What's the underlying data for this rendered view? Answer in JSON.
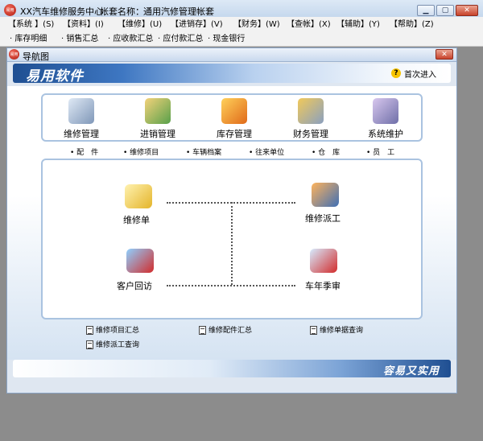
{
  "app": {
    "title": "XX汽车维修服务中心",
    "account_label": "帐套名称：",
    "account_name": "通用汽修管理帐套",
    "icon_text": "易用"
  },
  "menu": [
    {
      "label": "【系统 】(S)"
    },
    {
      "label": "【资料】(I)"
    },
    {
      "label": "【维修】(U)"
    },
    {
      "label": "【进销存】(V)"
    },
    {
      "label": "【财务】(W)"
    },
    {
      "label": "【查帐】(X)"
    },
    {
      "label": "【辅助】(Y)"
    },
    {
      "label": "【帮助】(Z)"
    }
  ],
  "quickbar": [
    {
      "label": "· 库存明细"
    },
    {
      "label": "· 销售汇总"
    },
    {
      "label": "· 应收款汇总"
    },
    {
      "label": "· 应付款汇总"
    },
    {
      "label": "· 现金银行"
    }
  ],
  "navwin": {
    "title": "导航图",
    "icon_text": "易用"
  },
  "banner": {
    "slogan": "易用软件",
    "first_time": "首次进入",
    "help_icon": "?"
  },
  "tools": [
    {
      "label": "维修管理",
      "icon": "car-gear-icon"
    },
    {
      "label": "进销管理",
      "icon": "boxes-icon"
    },
    {
      "label": "库存管理",
      "icon": "warehouse-icon"
    },
    {
      "label": "财务管理",
      "icon": "coins-icon"
    },
    {
      "label": "系统维护",
      "icon": "gears-icon"
    }
  ],
  "sublinks": [
    {
      "label": "• 配　件"
    },
    {
      "label": "• 维修项目"
    },
    {
      "label": "• 车辆档案"
    },
    {
      "label": "• 往来单位"
    },
    {
      "label": "• 仓　库"
    },
    {
      "label": "• 员　工"
    }
  ],
  "flow": {
    "repair_order": "维修单",
    "dispatch": "维修派工",
    "callback": "客户回访",
    "inspection": "车年季审"
  },
  "reports": [
    {
      "label": "维修项目汇总"
    },
    {
      "label": "维修配件汇总"
    },
    {
      "label": "维修单据查询"
    },
    {
      "label": "维修派工查询"
    }
  ],
  "footer": {
    "slogan": "容易又实用"
  },
  "colors": {
    "banner_dark": "#1f4f92",
    "panel_border": "#aac3e0",
    "desktop": "#8c8c8c"
  }
}
